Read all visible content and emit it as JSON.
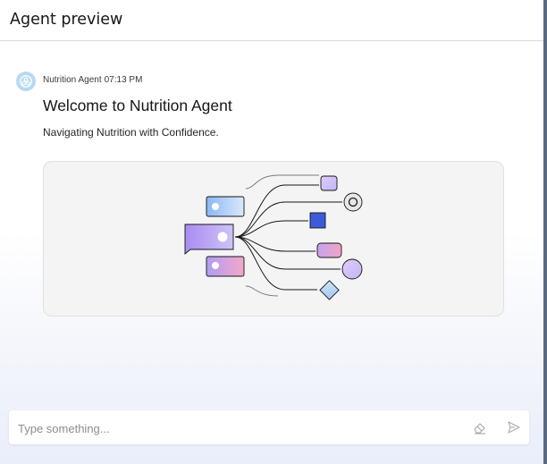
{
  "header": {
    "title": "Agent preview"
  },
  "message": {
    "sender": "Nutrition Agent",
    "time": "07:13 PM",
    "title": "Welcome to Nutrition Agent",
    "subtitle": "Navigating Nutrition with Confidence."
  },
  "input": {
    "placeholder": "Type something..."
  },
  "icons": {
    "avatar": "agent-avatar-icon",
    "clear": "eraser-icon",
    "send": "send-icon"
  },
  "colors": {
    "accent_blue": "#4a78b8",
    "square_blue": "#3b5bdb",
    "avatar_bg": "#b9d9f2",
    "purple": "#a98cf0"
  }
}
